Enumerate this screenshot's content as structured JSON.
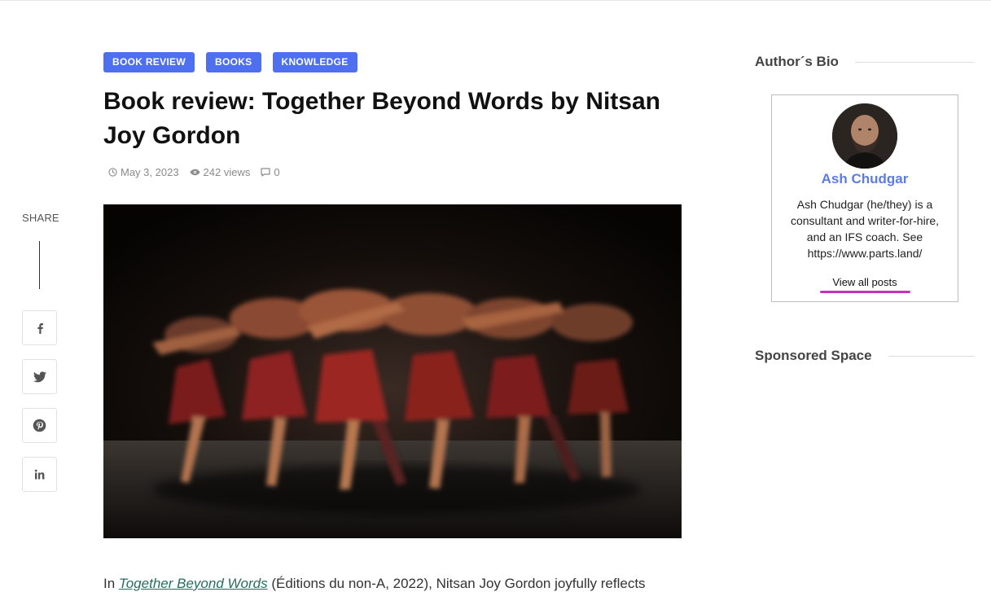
{
  "share": {
    "label": "SHARE",
    "buttons": [
      {
        "icon": "facebook-icon"
      },
      {
        "icon": "twitter-icon"
      },
      {
        "icon": "pinterest-icon"
      },
      {
        "icon": "linkedin-icon"
      }
    ]
  },
  "article": {
    "tags": [
      "BOOK REVIEW",
      "BOOKS",
      "KNOWLEDGE"
    ],
    "title": "Book review: Together Beyond Words by Nitsan Joy Gordon",
    "meta": {
      "date": "May 3, 2023",
      "views": "242 views",
      "comments": "0"
    },
    "image_alt": "Blurred dancers in red costumes on a dark stage",
    "intro": {
      "prefix": "In ",
      "book_title": "Together Beyond Words",
      "suffix": " (Éditions du non-A, 2022), Nitsan Joy Gordon joyfully reflects"
    }
  },
  "sidebar": {
    "author_bio_title": "Author´s Bio",
    "author": {
      "name": "Ash Chudgar",
      "bio": "Ash Chudgar (he/they) is a consultant and writer-for-hire, and an IFS coach. See https://www.parts.land/",
      "link_label": "View all posts"
    },
    "sponsored_title": "Sponsored Space"
  },
  "colors": {
    "tag_bg": "#4d6ff0",
    "author_name": "#5b7be6",
    "link_underline": "#c72fc0"
  }
}
